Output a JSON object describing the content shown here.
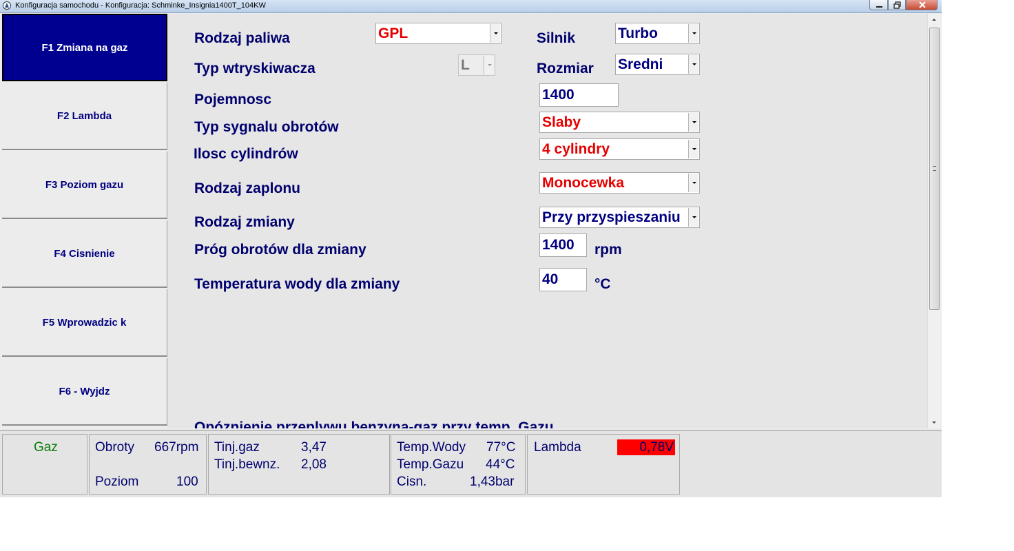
{
  "window": {
    "title": "Konfiguracja samochodu - Konfiguracja: Schminke_Insignia1400T_104KW"
  },
  "sidebar": {
    "items": [
      {
        "label": "F1 Zmiana na gaz"
      },
      {
        "label": "F2 Lambda"
      },
      {
        "label": "F3 Poziom gazu"
      },
      {
        "label": "F4 Cisnienie"
      },
      {
        "label": "F5 Wprowadzic k"
      },
      {
        "label": "F6 - Wyjdz"
      }
    ],
    "active_index": 0
  },
  "form": {
    "fuel_type": {
      "label": "Rodzaj paliwa",
      "value": "GPL"
    },
    "injector_type": {
      "label": "Typ wtryskiwacza",
      "value": "L"
    },
    "engine": {
      "label": "Silnik",
      "value": "Turbo"
    },
    "size": {
      "label": "Rozmiar",
      "value": "Sredni"
    },
    "capacity": {
      "label": "Pojemnosc",
      "value": "1400"
    },
    "rpm_signal_type": {
      "label": "Typ sygnalu obrotów",
      "value": "Slaby"
    },
    "cylinders": {
      "label": "Ilosc cylindrów",
      "value": "4 cylindry"
    },
    "ignition_type": {
      "label": "Rodzaj zaplonu",
      "value": "Monocewka"
    },
    "change_type": {
      "label": "Rodzaj zmiany",
      "value": "Przy przyspieszaniu"
    },
    "rpm_threshold": {
      "label": "Próg obrotów dla zmiany",
      "value": "1400",
      "unit": "rpm"
    },
    "water_temp": {
      "label": "Temperatura wody dla zmiany",
      "value": "40",
      "unit": "°C"
    },
    "cut_off_label": "Opóznienie przeplywu benzyna-gaz przy temp. Gazu"
  },
  "status": {
    "mode": "Gaz",
    "rpm_label": "Obroty",
    "rpm_value": "667rpm",
    "level_label": "Poziom",
    "level_value": "100",
    "tinj_gas_label": "Tinj.gaz",
    "tinj_gas_value": "3,47",
    "tinj_petrol_label": "Tinj.bewnz.",
    "tinj_petrol_value": "2,08",
    "water_temp_label": "Temp.Wody",
    "water_temp_value": "77°C",
    "gas_temp_label": "Temp.Gazu",
    "gas_temp_value": "44°C",
    "pressure_label": "Cisn.",
    "pressure_value": "1,43bar",
    "lambda_label": "Lambda",
    "lambda_value": "0,78V"
  },
  "colors": {
    "active_key_bg": "#000090",
    "label_text": "#00006e",
    "value_red": "#e60000",
    "lambda_bar": "#ff0000",
    "status_green": "#0a7a0a"
  },
  "icons": [
    "app-sail-icon",
    "minimize-icon",
    "maximize-icon",
    "close-icon",
    "dropdown-arrow-icon",
    "scroll-up-icon",
    "scroll-down-icon"
  ]
}
